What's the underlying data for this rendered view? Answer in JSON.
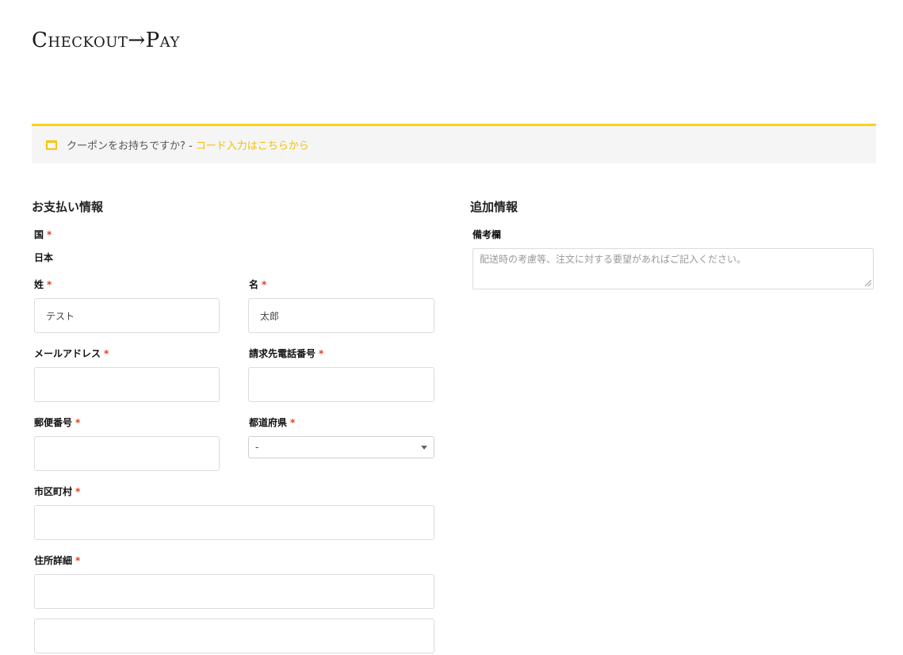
{
  "header": {
    "title": "Checkout→Pay"
  },
  "coupon": {
    "icon": "coupon-icon",
    "text": "クーポンをお持ちですか? -",
    "link": "コード入力はこちらから",
    "accent_color": "#f7d21b"
  },
  "billing": {
    "heading": "お支払い情報",
    "country": {
      "label": "国",
      "required_mark": "*",
      "value": "日本"
    },
    "last_name": {
      "label": "姓",
      "required_mark": "*",
      "value": "テスト"
    },
    "first_name": {
      "label": "名",
      "required_mark": "*",
      "value": "太郎"
    },
    "email": {
      "label": "メールアドレス",
      "required_mark": "*",
      "value": ""
    },
    "phone": {
      "label": "請求先電話番号",
      "required_mark": "*",
      "value": ""
    },
    "postcode": {
      "label": "郵便番号",
      "required_mark": "*",
      "value": ""
    },
    "prefecture": {
      "label": "都道府県",
      "required_mark": "*",
      "value": "-"
    },
    "city": {
      "label": "市区町村",
      "required_mark": "*",
      "value": ""
    },
    "address": {
      "label": "住所詳細",
      "required_mark": "*",
      "line1": "",
      "line2": ""
    }
  },
  "additional": {
    "heading": "追加情報",
    "notes": {
      "label": "備考欄",
      "placeholder": "配送時の考慮等、注文に対する要望があればご記入ください。"
    }
  }
}
